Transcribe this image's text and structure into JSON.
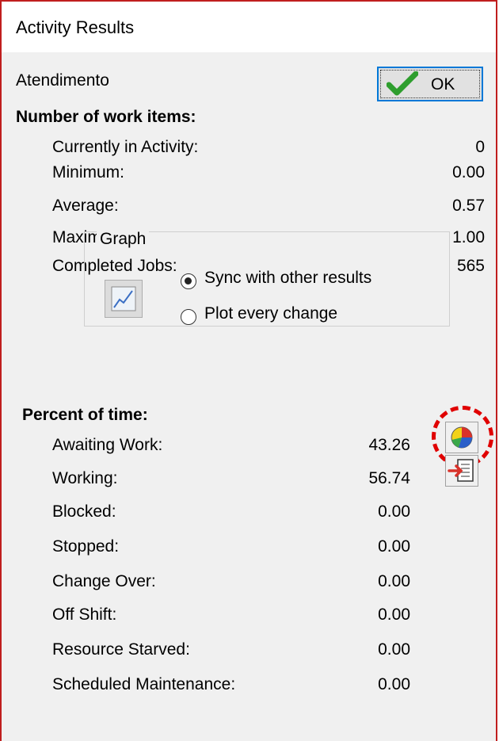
{
  "window": {
    "title": "Activity Results"
  },
  "activity_name": "Atendimento",
  "ok_label": "OK",
  "work_items": {
    "heading": "Number of work items:",
    "rows": [
      {
        "label": "Currently in Activity:",
        "value": "0"
      },
      {
        "label": "Minimum:",
        "value": "0.00"
      },
      {
        "label": "Average:",
        "value": "0.57"
      },
      {
        "label": "Maximum:",
        "value": "1.00"
      },
      {
        "label": "Completed Jobs:",
        "value": "565"
      }
    ]
  },
  "graph": {
    "legend": "Graph",
    "options": [
      {
        "label": "Sync with other results",
        "selected": true
      },
      {
        "label": "Plot every change",
        "selected": false
      }
    ]
  },
  "percent_time": {
    "heading": "Percent of time:",
    "rows": [
      {
        "label": "Awaiting Work:",
        "value": "43.26"
      },
      {
        "label": "Working:",
        "value": "56.74"
      },
      {
        "label": "Blocked:",
        "value": "0.00"
      },
      {
        "label": "Stopped:",
        "value": "0.00"
      },
      {
        "label": "Change Over:",
        "value": "0.00"
      },
      {
        "label": "Off Shift:",
        "value": "0.00"
      },
      {
        "label": "Resource Starved:",
        "value": "0.00"
      },
      {
        "label": "Scheduled Maintenance:",
        "value": "0.00"
      }
    ]
  },
  "icons": {
    "ok": "checkmark-icon",
    "graph": "line-graph-icon",
    "pie": "pie-chart-icon",
    "export": "export-icon"
  },
  "colors": {
    "highlight": "#e00000",
    "accent": "#0078d7",
    "check": "#2e9e2e"
  }
}
